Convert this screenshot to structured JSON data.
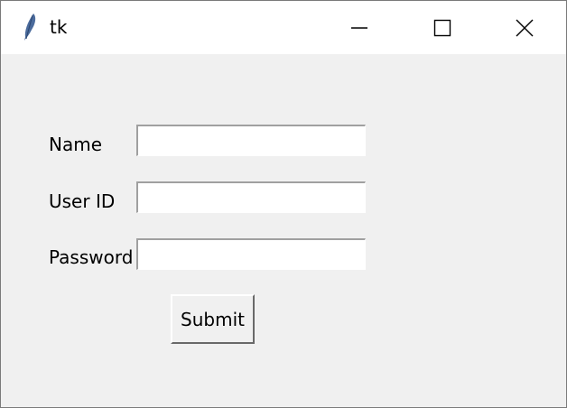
{
  "window": {
    "title": "tk",
    "icon": "tk-feather-icon",
    "controls": [
      "minimize-icon",
      "maximize-icon",
      "close-icon"
    ]
  },
  "form": {
    "fields": [
      {
        "label": "Name",
        "value": ""
      },
      {
        "label": "User ID",
        "value": ""
      },
      {
        "label": "Password",
        "value": ""
      }
    ],
    "submit_label": "Submit"
  },
  "colors": {
    "titlebar": "#ffffff",
    "window_bg": "#f0f0f0",
    "entry_bg": "#ffffff",
    "feather": "#4b6b9c"
  }
}
